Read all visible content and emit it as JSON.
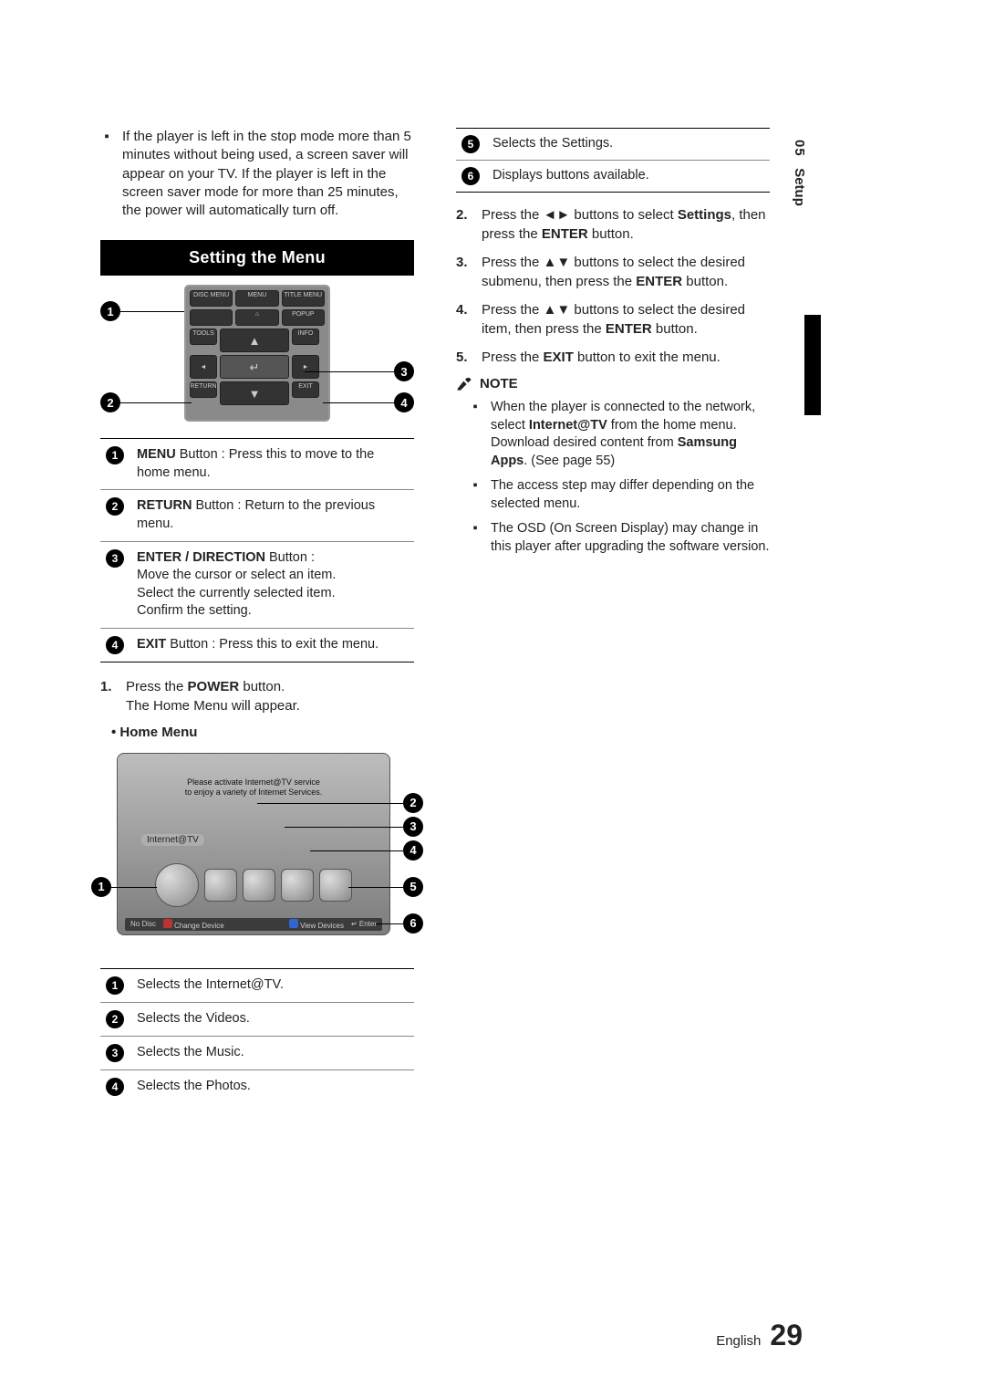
{
  "sidebar": {
    "chapter_num": "05",
    "chapter_title": "Setup"
  },
  "intro_bullet": "▪",
  "intro_text": "If the player is left in the stop mode more than 5 minutes without being used, a screen saver will appear on your TV. If the player is left in the screen saver mode for more than 25 minutes, the power will automatically turn off.",
  "section_title": "Setting the Menu",
  "remote_buttons": {
    "row1": [
      "DISC MENU",
      "MENU",
      "TITLE MENU"
    ],
    "row1_sub": [
      "",
      "⌂",
      "POPUP"
    ],
    "row2_left": "TOOLS",
    "row2_right": "INFO",
    "up": "▲",
    "down": "▼",
    "left": "◄",
    "right": "►",
    "center": "↵",
    "row4_left": "RETURN",
    "row4_right": "EXIT",
    "row4_left_sym": "↶",
    "row4_right_sym": "⇤"
  },
  "remote_table": [
    {
      "n": "1",
      "bold": "MENU",
      "rest": " Button : Press this to move to the home menu."
    },
    {
      "n": "2",
      "bold": "RETURN",
      "rest": " Button : Return to the previous menu."
    },
    {
      "n": "3",
      "bold": "ENTER / DIRECTION",
      "rest": " Button :\nMove the cursor or select an item.\nSelect the currently selected item.\nConfirm the setting."
    },
    {
      "n": "4",
      "bold": "EXIT",
      "rest": " Button : Press this to exit the menu."
    }
  ],
  "step1": {
    "num": "1.",
    "l1_a": "Press the ",
    "l1_b": "POWER",
    "l1_c": " button.",
    "l2": "The Home Menu will appear."
  },
  "home_menu_heading": "• Home Menu",
  "home_menu": {
    "msg_l1": "Please activate Internet@TV service",
    "msg_l2": "to enjoy a variety of Internet Services.",
    "label": "Internet@TV",
    "bar_no_disc": "No Disc",
    "bar_change": "Change Device",
    "bar_view": "View Devices",
    "bar_enter": "↵ Enter"
  },
  "home_table_left": [
    {
      "n": "1",
      "t": "Selects the Internet@TV."
    },
    {
      "n": "2",
      "t": "Selects the Videos."
    },
    {
      "n": "3",
      "t": "Selects the Music."
    },
    {
      "n": "4",
      "t": "Selects the Photos."
    }
  ],
  "home_table_right": [
    {
      "n": "5",
      "t": "Selects the Settings."
    },
    {
      "n": "6",
      "t": "Displays buttons available."
    }
  ],
  "steps_right": [
    {
      "num": "2.",
      "pre": "Press the ",
      "sym": "◄►",
      "mid": " buttons to select ",
      "bold": "Settings",
      "post1": ", then press the ",
      "bold2": "ENTER",
      "post2": " button."
    },
    {
      "num": "3.",
      "pre": "Press the ",
      "sym": "▲▼",
      "mid": " buttons to select the desired submenu, then press the ",
      "bold": "ENTER",
      "post": " button."
    },
    {
      "num": "4.",
      "pre": "Press the ",
      "sym": "▲▼",
      "mid": " buttons to select the desired item, then press the ",
      "bold": "ENTER",
      "post": " button."
    },
    {
      "num": "5.",
      "pre": "Press the ",
      "bold": "EXIT",
      "post": " button to exit the menu."
    }
  ],
  "note_label": "NOTE",
  "notes": [
    {
      "pre": "When the player is connected to the network, select ",
      "b1": "Internet@TV",
      "mid": " from the home menu.\nDownload desired content from ",
      "b2": "Samsung Apps",
      "post": ". (See page 55)"
    },
    {
      "text": "The access step may differ depending on the selected menu."
    },
    {
      "text": "The OSD (On Screen Display) may change in this player after upgrading the software version."
    }
  ],
  "footer": {
    "lang": "English",
    "page": "29"
  }
}
